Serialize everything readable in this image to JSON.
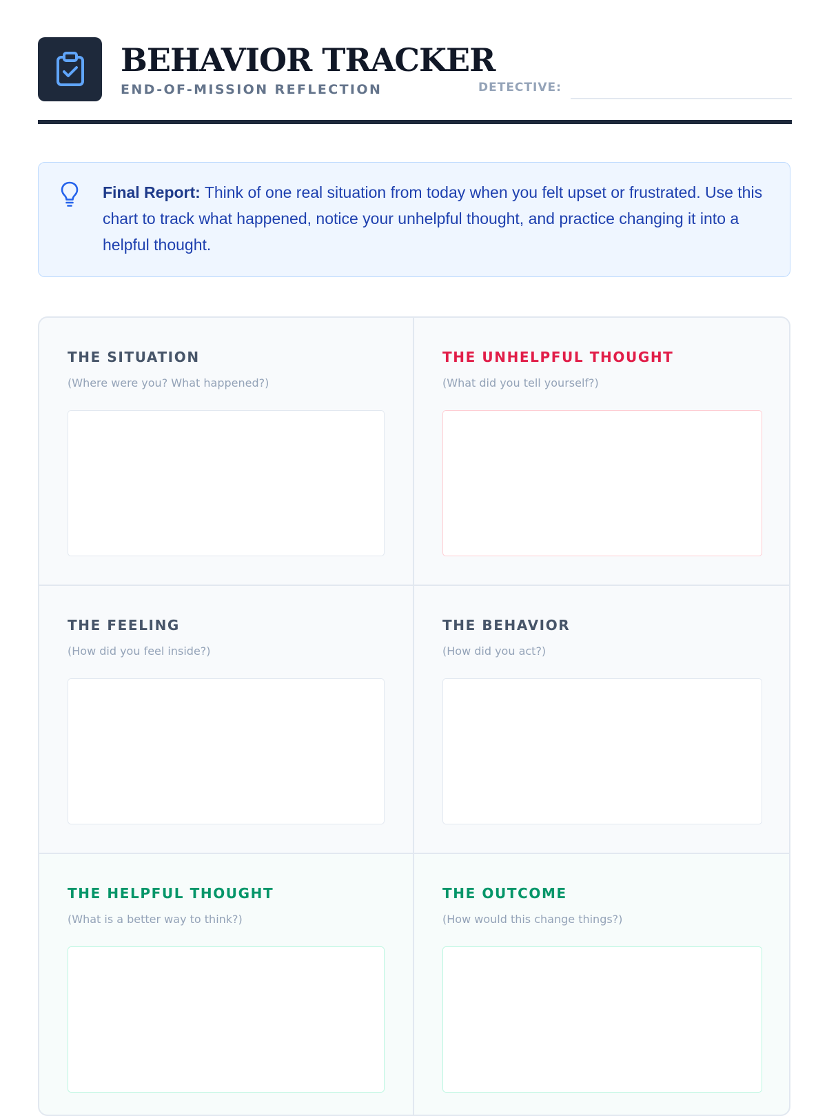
{
  "header": {
    "title": "BEHAVIOR TRACKER",
    "subtitle": "END-OF-MISSION REFLECTION",
    "detective_label": "DETECTIVE:",
    "detective_value": ""
  },
  "callout": {
    "lead": "Final Report:",
    "body": " Think of one real situation from today when you felt upset or frustrated. Use this chart to track what happened, notice your unhelpful thought, and practice changing it into a helpful thought."
  },
  "cells": [
    {
      "title": "THE SITUATION",
      "hint": "(Where were you? What happened?)",
      "value": ""
    },
    {
      "title": "THE UNHELPFUL THOUGHT",
      "hint": "(What did you tell yourself?)",
      "value": ""
    },
    {
      "title": "THE FEELING",
      "hint": "(How did you feel inside?)",
      "value": ""
    },
    {
      "title": "THE BEHAVIOR",
      "hint": "(How did you act?)",
      "value": ""
    },
    {
      "title": "THE HELPFUL THOUGHT",
      "hint": "(What is a better way to think?)",
      "value": ""
    },
    {
      "title": "THE OUTCOME",
      "hint": "(How would this change things?)",
      "value": ""
    }
  ],
  "colors": {
    "brand_dark": "#1e293b",
    "neutral_heading": "#475569",
    "unhelpful_red": "#e11d48",
    "helpful_green": "#059669",
    "callout_blue": "#1e40af"
  },
  "icons": {
    "logo": "clipboard-check-icon",
    "callout": "lightbulb-icon"
  }
}
